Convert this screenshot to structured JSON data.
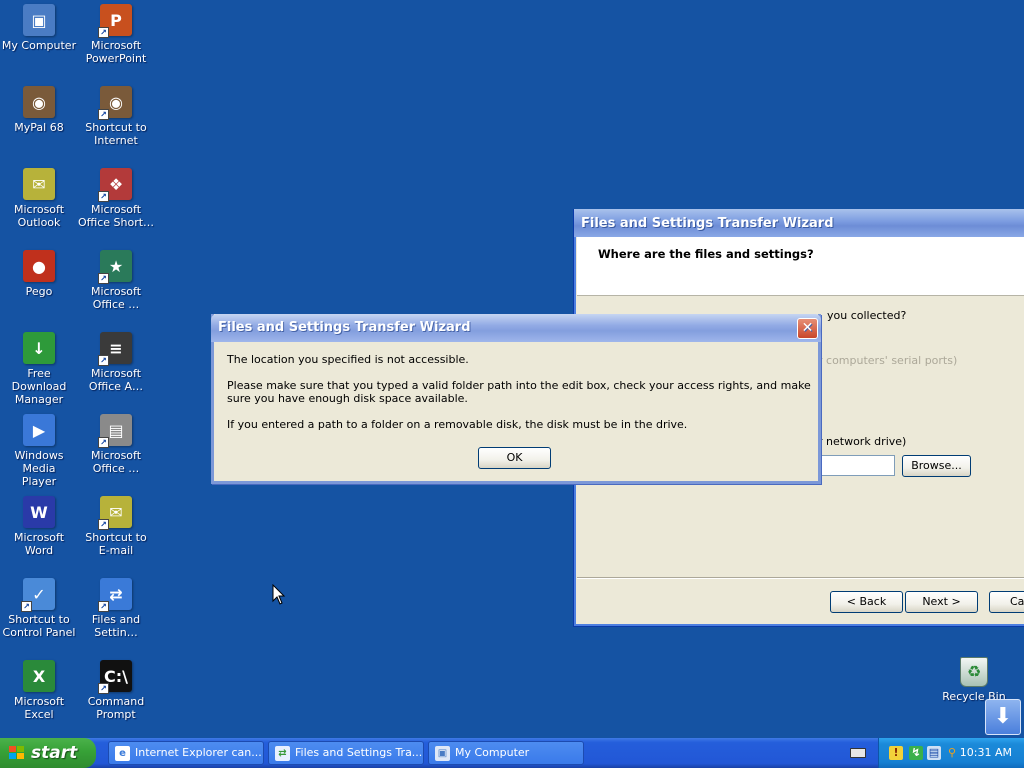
{
  "desktop": {
    "icons": [
      {
        "label": "My Computer",
        "glyph": "▣",
        "color": "#4a7cc4",
        "shortcut": false
      },
      {
        "label": "Microsoft\nPowerPoint",
        "glyph": "P",
        "color": "#c8501e",
        "shortcut": true
      },
      {
        "label": "MyPal 68",
        "glyph": "◉",
        "color": "#7a5a3a",
        "shortcut": false
      },
      {
        "label": "Shortcut to\nInternet",
        "glyph": "◉",
        "color": "#7a5a3a",
        "shortcut": true
      },
      {
        "label": "Microsoft\nOutlook",
        "glyph": "✉",
        "color": "#b7b23a",
        "shortcut": false
      },
      {
        "label": "Microsoft\nOffice Short…",
        "glyph": "❖",
        "color": "#b33a3a",
        "shortcut": true
      },
      {
        "label": "Pego",
        "glyph": "●",
        "color": "#c0301c",
        "shortcut": false
      },
      {
        "label": "Microsoft\nOffice …",
        "glyph": "★",
        "color": "#2a7a5a",
        "shortcut": true
      },
      {
        "label": "Free Download\nManager",
        "glyph": "↓",
        "color": "#2e9a3a",
        "shortcut": false
      },
      {
        "label": "Microsoft\nOffice A…",
        "glyph": "≡",
        "color": "#3a3a3a",
        "shortcut": true
      },
      {
        "label": "Windows Media\nPlayer",
        "glyph": "▶",
        "color": "#3a78d8",
        "shortcut": false
      },
      {
        "label": "Microsoft\nOffice …",
        "glyph": "▤",
        "color": "#8a8a8a",
        "shortcut": true
      },
      {
        "label": "Microsoft Word",
        "glyph": "W",
        "color": "#2a3aa8",
        "shortcut": false
      },
      {
        "label": "Shortcut to\nE-mail",
        "glyph": "✉",
        "color": "#b7b23a",
        "shortcut": true
      },
      {
        "label": "Shortcut to\nControl Panel",
        "glyph": "✓",
        "color": "#4a8ad8",
        "shortcut": true
      },
      {
        "label": "Files and\nSettin…",
        "glyph": "⇄",
        "color": "#3a7ad8",
        "shortcut": true
      },
      {
        "label": "Microsoft Excel",
        "glyph": "X",
        "color": "#2a8a3a",
        "shortcut": false
      },
      {
        "label": "Command\nPrompt",
        "glyph": "C:\\",
        "color": "#111111",
        "shortcut": true
      }
    ],
    "recycle_bin": {
      "label": "Recycle Bin"
    }
  },
  "wizard": {
    "title": "Files and Settings Transfer Wizard",
    "question": "Where are the files and settings?",
    "prompt_fragment": "you collected?",
    "serial_fragment": "r computers' serial ports)",
    "network_fragment": "r network drive)",
    "browse_label": "Browse...",
    "back_label": "< Back",
    "next_label": "Next >",
    "cancel_label": "Ca"
  },
  "dialog": {
    "title": "Files and Settings Transfer Wizard",
    "line1": "The location you specified is not accessible.",
    "line2": "Please make sure that you typed a valid folder path into the edit box, check your access rights, and make sure you have enough disk space available.",
    "line3": "If you entered a path to a folder on a removable disk, the disk must be in the drive.",
    "ok_label": "OK",
    "close_glyph": "✕"
  },
  "taskbar": {
    "start_label": "start",
    "buttons": [
      {
        "label": "Internet Explorer can...",
        "icon": "e",
        "icon_color": "#3a7ad8"
      },
      {
        "label": "Files and Settings Tra...",
        "icon": "⇄",
        "icon_color": "#3a9a3a"
      },
      {
        "label": "My Computer",
        "icon": "▣",
        "icon_color": "#4a7cc4"
      }
    ],
    "clock": "10:31 AM"
  }
}
